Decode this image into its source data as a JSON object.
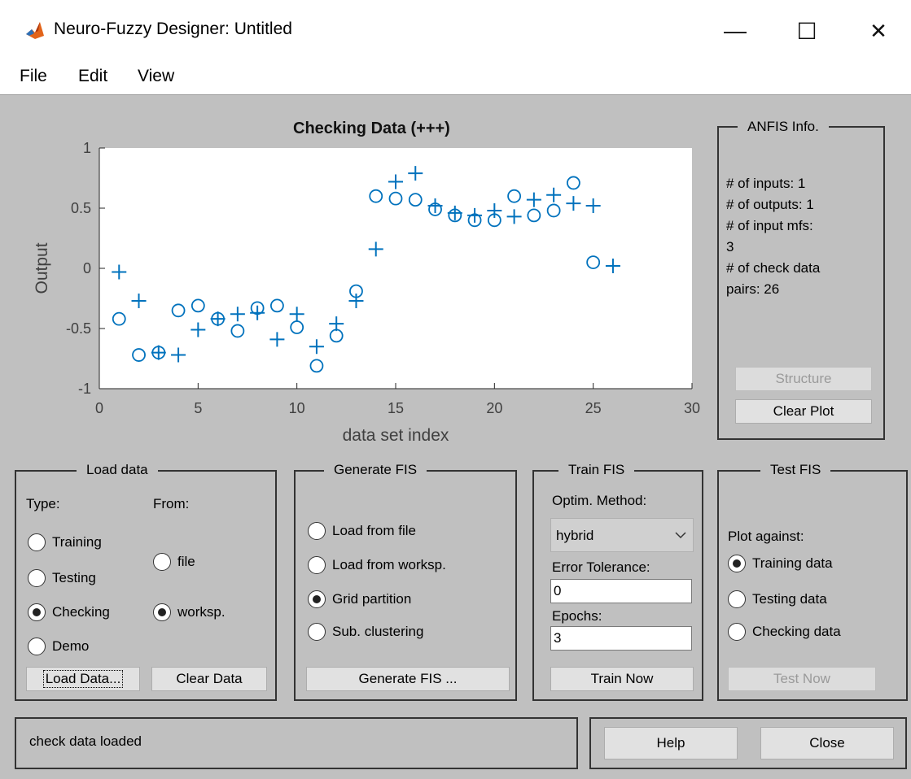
{
  "window": {
    "title": "Neuro-Fuzzy Designer: Untitled",
    "minimize": "—",
    "maximize": "☐",
    "close": "✕"
  },
  "menu": [
    "File",
    "Edit",
    "View"
  ],
  "plot": {
    "title": "Checking Data (+++)",
    "xlabel": "data set index",
    "ylabel": "Output",
    "xticks": [
      "0",
      "5",
      "10",
      "15",
      "20",
      "25",
      "30"
    ],
    "yticks": [
      "1",
      "0.5",
      "0",
      "-0.5",
      "-1"
    ]
  },
  "chart_data": {
    "type": "scatter",
    "title": "Checking Data (+++)",
    "xlabel": "data set index",
    "ylabel": "Output",
    "xlim": [
      0,
      30
    ],
    "ylim": [
      -1,
      1
    ],
    "grid": false,
    "color": "#0072bd",
    "series": [
      {
        "marker": "plus",
        "points": [
          [
            1,
            -0.03
          ],
          [
            2,
            -0.27
          ],
          [
            3,
            -0.7
          ],
          [
            4,
            -0.72
          ],
          [
            5,
            -0.51
          ],
          [
            6,
            -0.42
          ],
          [
            7,
            -0.38
          ],
          [
            8,
            -0.37
          ],
          [
            9,
            -0.59
          ],
          [
            10,
            -0.38
          ],
          [
            11,
            -0.65
          ],
          [
            12,
            -0.46
          ],
          [
            13,
            -0.27
          ],
          [
            14,
            0.16
          ],
          [
            15,
            0.72
          ],
          [
            16,
            0.79
          ],
          [
            17,
            0.52
          ],
          [
            18,
            0.46
          ],
          [
            19,
            0.44
          ],
          [
            20,
            0.48
          ],
          [
            21,
            0.43
          ],
          [
            22,
            0.57
          ],
          [
            23,
            0.61
          ],
          [
            24,
            0.54
          ],
          [
            25,
            0.52
          ],
          [
            26,
            0.02
          ]
        ]
      },
      {
        "marker": "circle",
        "points": [
          [
            1,
            -0.42
          ],
          [
            2,
            -0.72
          ],
          [
            3,
            -0.7
          ],
          [
            4,
            -0.35
          ],
          [
            5,
            -0.31
          ],
          [
            6,
            -0.42
          ],
          [
            7,
            -0.52
          ],
          [
            8,
            -0.33
          ],
          [
            9,
            -0.31
          ],
          [
            10,
            -0.49
          ],
          [
            11,
            -0.81
          ],
          [
            12,
            -0.56
          ],
          [
            13,
            -0.19
          ],
          [
            14,
            0.6
          ],
          [
            15,
            0.58
          ],
          [
            16,
            0.57
          ],
          [
            17,
            0.49
          ],
          [
            18,
            0.44
          ],
          [
            19,
            0.4
          ],
          [
            20,
            0.4
          ],
          [
            21,
            0.6
          ],
          [
            22,
            0.44
          ],
          [
            23,
            0.48
          ],
          [
            24,
            0.71
          ],
          [
            25,
            0.05
          ]
        ]
      }
    ]
  },
  "anfis_info": {
    "title": "ANFIS Info.",
    "lines": [
      "# of inputs: 1",
      "# of outputs: 1",
      "# of input mfs:",
      "3",
      "# of check data",
      "pairs: 26"
    ],
    "structure_button": "Structure",
    "clear_plot_button": "Clear Plot"
  },
  "load_data": {
    "title": "Load data",
    "type_label": "Type:",
    "from_label": "From:",
    "type_options": [
      "Training",
      "Testing",
      "Checking",
      "Demo"
    ],
    "type_selected": "Checking",
    "from_options": [
      "file",
      "worksp."
    ],
    "from_selected": "worksp.",
    "load_button": "Load Data...",
    "clear_button": "Clear Data"
  },
  "generate_fis": {
    "title": "Generate FIS",
    "options": [
      "Load from file",
      "Load from worksp.",
      "Grid partition",
      "Sub. clustering"
    ],
    "selected": "Grid partition",
    "button": "Generate FIS ..."
  },
  "train_fis": {
    "title": "Train FIS",
    "method_label": "Optim. Method:",
    "method_value": "hybrid",
    "error_label": "Error Tolerance:",
    "error_value": "0",
    "epochs_label": "Epochs:",
    "epochs_value": "3",
    "button": "Train Now"
  },
  "test_fis": {
    "title": "Test FIS",
    "plot_against_label": "Plot against:",
    "options": [
      "Training data",
      "Testing data",
      "Checking data"
    ],
    "selected": "Training data",
    "button": "Test Now"
  },
  "status": "check data loaded",
  "help_button": "Help",
  "close_button": "Close"
}
